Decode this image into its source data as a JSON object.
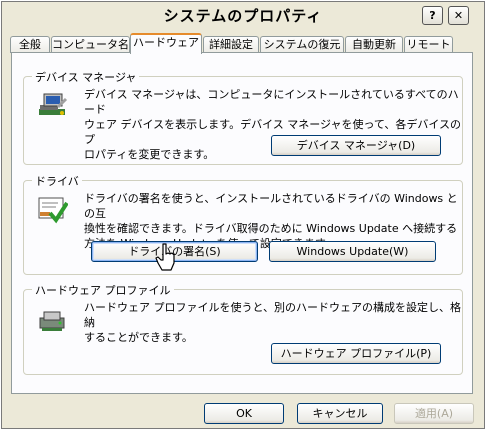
{
  "window": {
    "title": "システムのプロパティ",
    "help_label": "?",
    "close_label": "✕"
  },
  "tabs": [
    {
      "label": "全般"
    },
    {
      "label": "コンピュータ名"
    },
    {
      "label": "ハードウェア"
    },
    {
      "label": "詳細設定"
    },
    {
      "label": "システムの復元"
    },
    {
      "label": "自動更新"
    },
    {
      "label": "リモート"
    }
  ],
  "device_manager": {
    "title": "デバイス マネージャ",
    "description_lines": [
      "デバイス マネージャは、コンピュータにインストールされているすべてのハード",
      "ウェア デバイスを表示します。デバイス マネージャを使って、各デバイスのプ",
      "ロパティを変更できます。"
    ],
    "button_label": "デバイス マネージャ(D)"
  },
  "drivers": {
    "title": "ドライバ",
    "description_lines": [
      "ドライバの署名を使うと、インストールされているドライバの Windows との互",
      "換性を確認できます。ドライバ取得のために Windows Update へ接続する",
      "方法を Windows Update を使って設定できます。"
    ],
    "signing_button_label": "ドライバの署名(S)",
    "update_button_label": "Windows Update(W)"
  },
  "hardware_profiles": {
    "title": "ハードウェア プロファイル",
    "description_lines": [
      "ハードウェア プロファイルを使うと、別のハードウェアの構成を設定し、格納",
      "することができます。"
    ],
    "button_label": "ハードウェア プロファイル(P)"
  },
  "footer": {
    "ok_label": "OK",
    "cancel_label": "キャンセル",
    "apply_label": "適用(A)"
  },
  "colors": {
    "dialog_bg": "#ece9d8",
    "panel_bg": "#fcfcfe",
    "active_tab_accent": "#e68b2c",
    "button_border": "#003c74"
  },
  "icons": [
    "device-manager-icon",
    "driver-signing-icon",
    "hardware-profile-icon",
    "mouse-pointer-icon"
  ]
}
